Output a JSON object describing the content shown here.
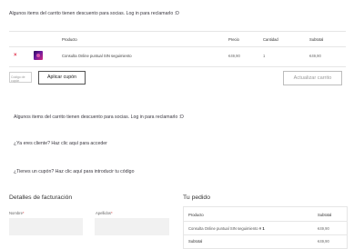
{
  "notices": {
    "members_discount": "Algunos items del carrito tienen descuento para socias. Log in para reclamarlo :D",
    "returning_customer": "¿Ya eres cliente? Haz clic aquí para acceder",
    "have_coupon": "¿Tienes un cupón? Haz clic aquí para introducir tu código"
  },
  "cart": {
    "headers": {
      "product": "Producto",
      "price": "Precio",
      "quantity": "Cantidad",
      "subtotal": "Subtotal"
    },
    "row": {
      "remove": "×",
      "product": "Consulta Online puntual SIN seguimiento",
      "price": "€49,90",
      "quantity": "1",
      "subtotal": "€49,90"
    },
    "coupon_placeholder": "Código de cupón",
    "apply_coupon": "Aplicar cupón",
    "update_cart": "Actualizar carrito"
  },
  "billing": {
    "title": "Detalles de facturación",
    "first_name_label": "Nombre",
    "last_name_label": "Apellidos",
    "required_mark": "*"
  },
  "order": {
    "title": "Tu pedido",
    "header_product": "Producto",
    "header_subtotal": "Subtotal",
    "item": "Consulta Online puntual SIN seguimiento",
    "item_qty": "× 1",
    "item_total": "€49,90",
    "subtotal_label": "Subtotal",
    "subtotal_value": "€49,90"
  },
  "colors": {
    "remove": "#e0314b",
    "required": "#d63638"
  }
}
